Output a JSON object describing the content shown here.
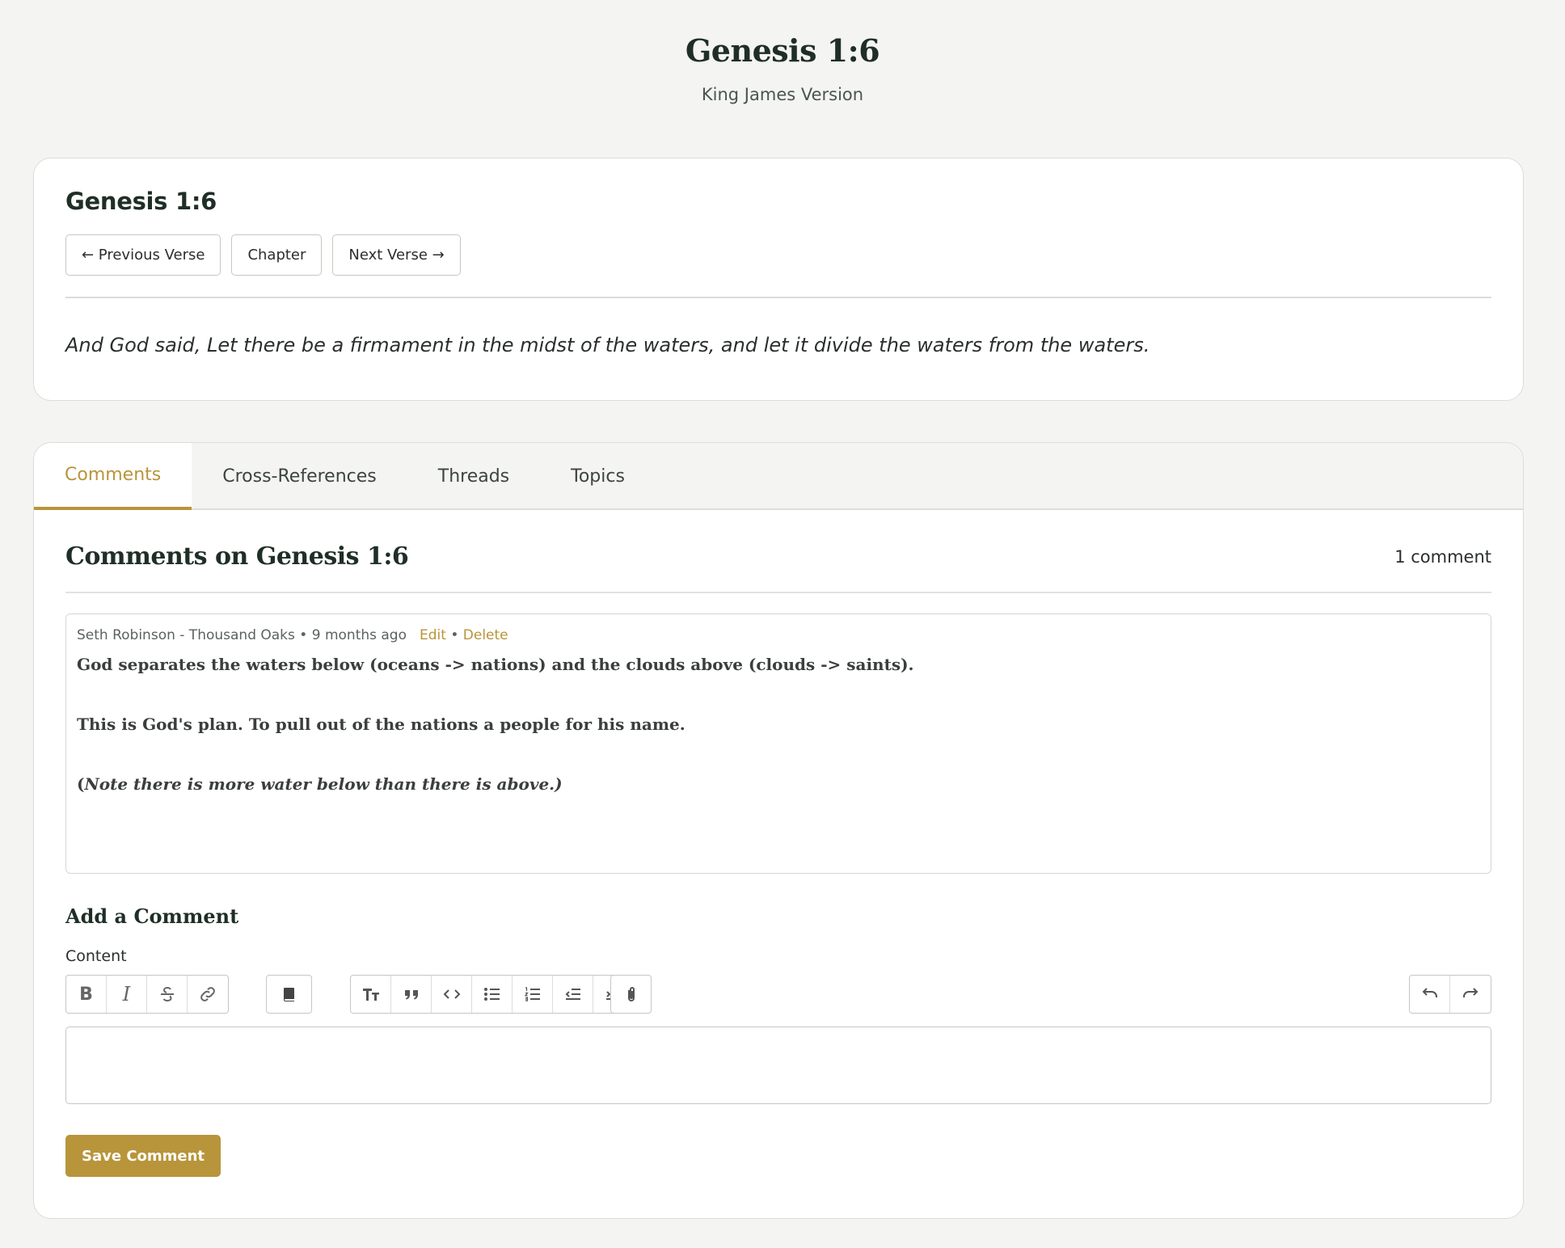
{
  "header": {
    "title": "Genesis 1:6",
    "subtitle": "King James Version"
  },
  "verse": {
    "heading": "Genesis 1:6",
    "prev_label": "← Previous Verse",
    "chapter_label": "Chapter",
    "next_label": "Next Verse →",
    "text": "And God said, Let there be a firmament in the midst of the waters, and let it divide the waters from the waters."
  },
  "tabs": [
    {
      "label": "Comments",
      "active": true
    },
    {
      "label": "Cross-References",
      "active": false
    },
    {
      "label": "Threads",
      "active": false
    },
    {
      "label": "Topics",
      "active": false
    }
  ],
  "comments": {
    "title": "Comments on Genesis 1:6",
    "count": "1 comment",
    "items": [
      {
        "author": "Seth Robinson - Thousand Oaks",
        "separator": " • ",
        "time": "9 months ago",
        "edit_label": "Edit",
        "delete_label": "Delete",
        "line1": "God separates the waters below (oceans -> nations) and the clouds above (clouds -> saints).",
        "line2": "This is God's plan. To pull out of the nations a people for his name.",
        "line3_open": "(",
        "line3": "Note there is more water below than there is above.)"
      }
    ]
  },
  "add_comment": {
    "title": "Add a Comment",
    "content_label": "Content",
    "save_label": "Save Comment"
  },
  "toolbar": {
    "bold": "B",
    "italic": "I",
    "icons": [
      "bold-icon",
      "italic-icon",
      "strikethrough-icon",
      "link-icon",
      "bible-book-icon",
      "heading-icon",
      "quote-icon",
      "code-icon",
      "bullet-list-icon",
      "numbered-list-icon",
      "outdent-icon",
      "indent-icon",
      "attachment-icon",
      "undo-icon",
      "redo-icon"
    ]
  },
  "colors": {
    "accent": "#b8953b",
    "background": "#f4f4f2",
    "text": "#1f2e26"
  }
}
